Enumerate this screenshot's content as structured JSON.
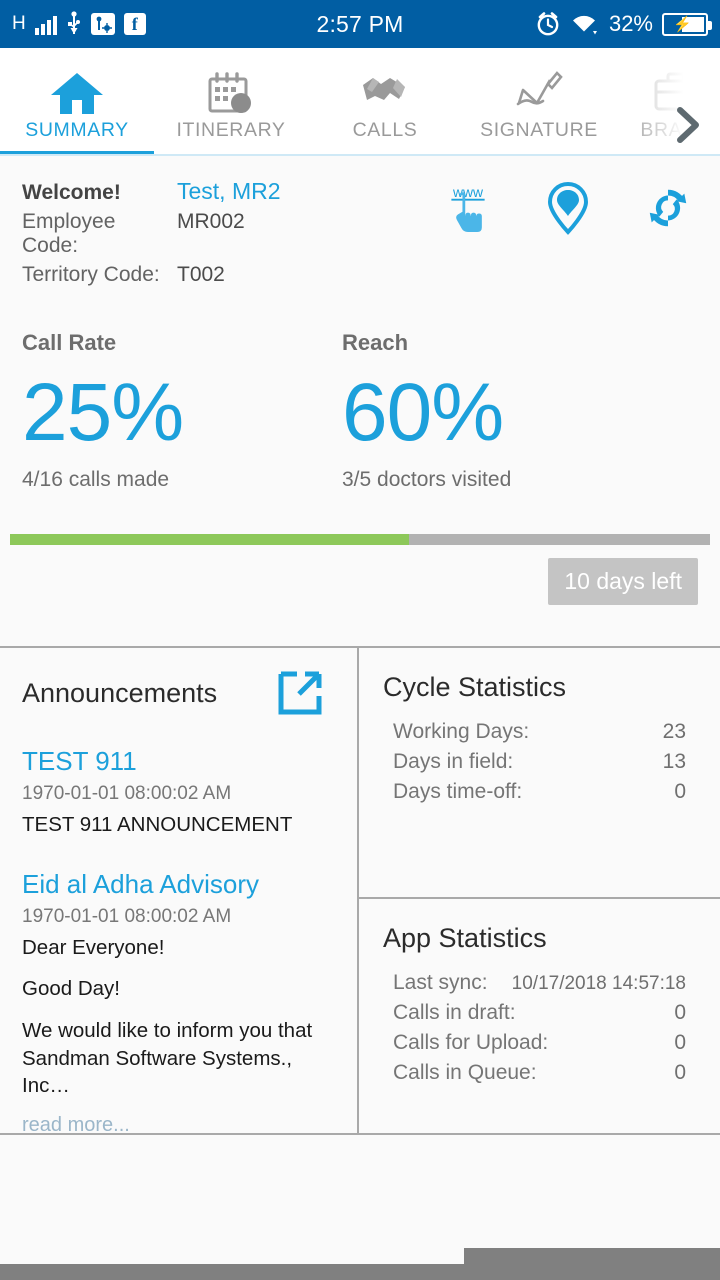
{
  "status_bar": {
    "network_type": "H",
    "time": "2:57 PM",
    "battery_percent": "32%",
    "icons": [
      "signal-bars-icon",
      "usb-icon",
      "usb-debug-icon",
      "facebook-icon",
      "alarm-icon",
      "wifi-icon",
      "battery-charging-icon"
    ]
  },
  "tabs": [
    {
      "label": "SUMMARY",
      "icon": "home-icon",
      "active": true
    },
    {
      "label": "ITINERARY",
      "icon": "calendar-icon",
      "active": false
    },
    {
      "label": "CALLS",
      "icon": "handshake-icon",
      "active": false
    },
    {
      "label": "SIGNATURE",
      "icon": "signature-icon",
      "active": false
    },
    {
      "label": "BRAND",
      "icon": "briefcase-icon",
      "active": false
    }
  ],
  "welcome": {
    "greeting": "Welcome!",
    "user_name": "Test, MR2",
    "employee_code_label": "Employee Code:",
    "employee_code_value": "MR002",
    "territory_code_label": "Territory Code:",
    "territory_code_value": "T002",
    "actions": [
      "www-click-icon",
      "location-pin-icon",
      "sync-icon"
    ]
  },
  "kpis": [
    {
      "title": "Call Rate",
      "value": "25%",
      "subtitle": "4/16 calls made"
    },
    {
      "title": "Reach",
      "value": "60%",
      "subtitle": "3/5 doctors visited"
    }
  ],
  "cycle_progress": {
    "percent": 57,
    "days_left_label": "10 days left"
  },
  "announcements": {
    "title": "Announcements",
    "expand_icon": "external-link-icon",
    "read_more_label": "read more...",
    "items": [
      {
        "title": "TEST 911",
        "date": "1970-01-01 08:00:02 AM",
        "body_lines": [
          "TEST 911 ANNOUNCEMENT"
        ],
        "has_read_more": false
      },
      {
        "title": "Eid al Adha Advisory",
        "date": "1970-01-01 08:00:02 AM",
        "body_lines": [
          "Dear Everyone!",
          "Good Day!",
          "We would like to inform you that Sandman Software Systems., Inc…"
        ],
        "has_read_more": true
      }
    ]
  },
  "cycle_statistics": {
    "title": "Cycle Statistics",
    "rows": [
      {
        "label": "Working Days:",
        "value": "23"
      },
      {
        "label": "Days in field:",
        "value": "13"
      },
      {
        "label": "Days time-off:",
        "value": "0"
      }
    ]
  },
  "app_statistics": {
    "title": "App Statistics",
    "rows": [
      {
        "label": "Last sync:",
        "value": "10/17/2018 14:57:18",
        "small": true
      },
      {
        "label": "Calls in draft:",
        "value": "0",
        "small": false
      },
      {
        "label": "Calls for Upload:",
        "value": "0",
        "small": false
      },
      {
        "label": "Calls in Queue:",
        "value": "0",
        "small": false
      }
    ]
  },
  "colors": {
    "status_bar": "#015EA3",
    "accent_blue": "#1CA0DB",
    "progress_green": "#8DC85A",
    "progress_track": "#b2b2b2",
    "badge_gray": "#c4c4c4",
    "navbar_gray": "#808080"
  }
}
